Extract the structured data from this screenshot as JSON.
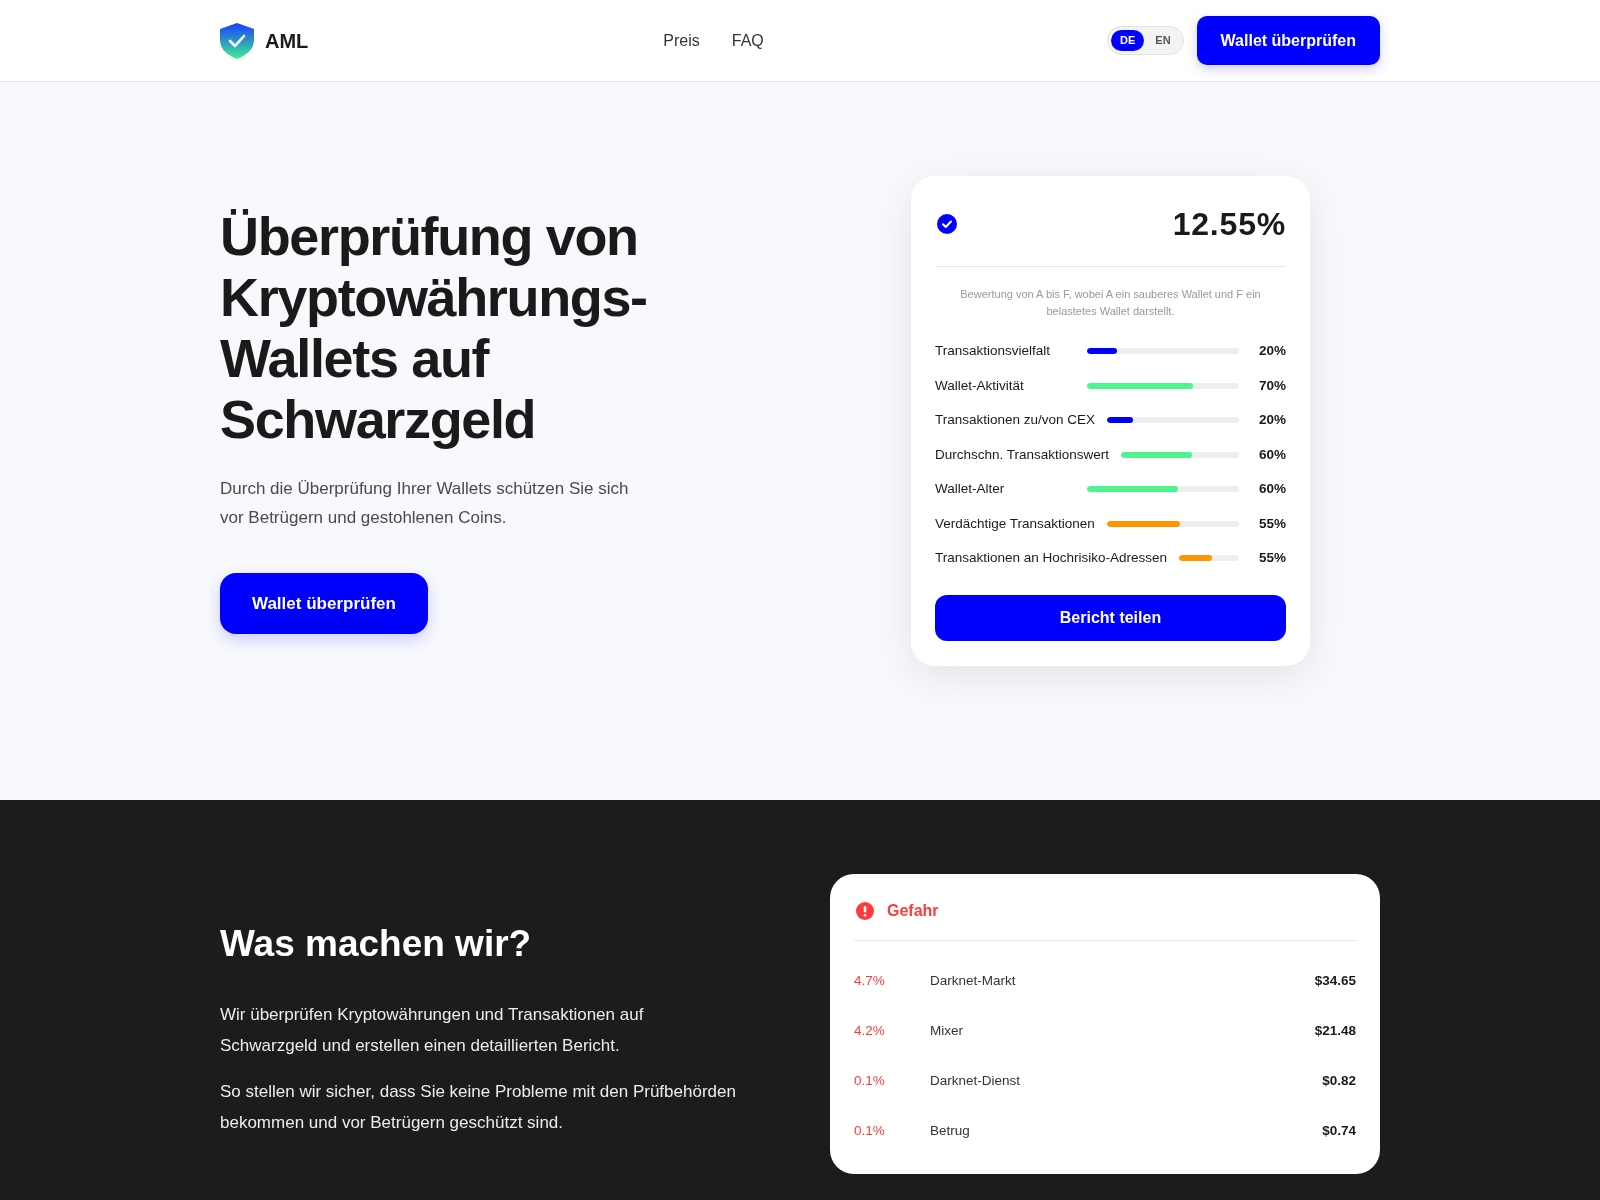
{
  "header": {
    "logo_text": "AML",
    "nav": [
      {
        "label": "Preis"
      },
      {
        "label": "FAQ"
      }
    ],
    "languages": [
      {
        "label": "DE",
        "selected": true
      },
      {
        "label": "EN",
        "selected": false
      }
    ],
    "cta": "Wallet überprüfen"
  },
  "hero": {
    "title": "Überprüfung von Kryptowährungs-Wallets auf Schwarzgeld",
    "subtitle": "Durch die Überprüfung Ihrer Wallets schützen Sie sich vor Betrügern und gestohlenen Coins.",
    "cta": "Wallet überprüfen",
    "score_card": {
      "score": "12.55%",
      "description": "Bewertung von A bis F, wobei A ein sauberes Wallet und F ein belastetes Wallet darstellt.",
      "metrics": [
        {
          "label": "Transaktionsvielfalt",
          "level": 0.2,
          "color": "#0000ff",
          "reading": "20%"
        },
        {
          "label": "Wallet-Aktivität",
          "level": 0.7,
          "color": "#4cf58e",
          "reading": "70%"
        },
        {
          "label": "Transaktionen zu/von CEX",
          "level": 0.2,
          "color": "#0000ff",
          "reading": "20%"
        },
        {
          "label": "Durchschn. Transaktionswert",
          "level": 0.6,
          "color": "#4cf58e",
          "reading": "60%"
        },
        {
          "label": "Wallet-Alter",
          "level": 0.6,
          "color": "#4cf58e",
          "reading": "60%"
        },
        {
          "label": "Verdächtige Transaktionen",
          "level": 0.55,
          "color": "#ff9500",
          "reading": "55%"
        },
        {
          "label": "Transaktionen an Hochrisiko-Adressen",
          "level": 0.55,
          "color": "#ff9500",
          "reading": "55%"
        }
      ],
      "button": "Bericht teilen"
    }
  },
  "about": {
    "title": "Was machen wir?",
    "paragraphs": [
      "Wir überprüfen Kryptowährungen und Transaktionen auf Schwarzgeld und erstellen einen detaillierten Bericht.",
      "So stellen wir sicher, dass Sie keine Probleme mit den Prüfbehörden bekommen und vor Betrügern geschützt sind."
    ],
    "risk_card": {
      "title": "Gefahr",
      "rows": [
        {
          "share": "4.7%",
          "category": "Darknet-Markt",
          "amount": "$34.65"
        },
        {
          "share": "4.2%",
          "category": "Mixer",
          "amount": "$21.48"
        },
        {
          "share": "0.1%",
          "category": "Darknet-Dienst",
          "amount": "$0.82"
        },
        {
          "share": "0.1%",
          "category": "Betrug",
          "amount": "$0.74"
        }
      ]
    }
  }
}
